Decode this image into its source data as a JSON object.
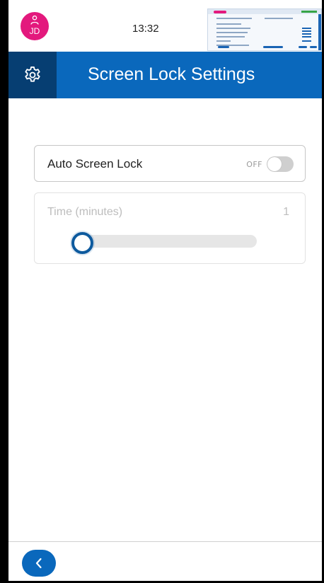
{
  "status_bar": {
    "avatar_initials": "JD",
    "time": "13:32"
  },
  "header": {
    "title": "Screen Lock Settings"
  },
  "auto_lock": {
    "label": "Auto Screen Lock",
    "state_text": "OFF",
    "enabled": false
  },
  "time_setting": {
    "label": "Time (minutes)",
    "value": "1",
    "slider_fraction": 0,
    "disabled": true
  },
  "icons": {
    "settings": "gear-icon",
    "back": "chevron-left-icon",
    "user": "user-icon"
  },
  "colors": {
    "primary": "#0a68bc",
    "primary_dark": "#063e72",
    "avatar": "#e3197d",
    "slider_thumb": "#0d5a9e"
  }
}
